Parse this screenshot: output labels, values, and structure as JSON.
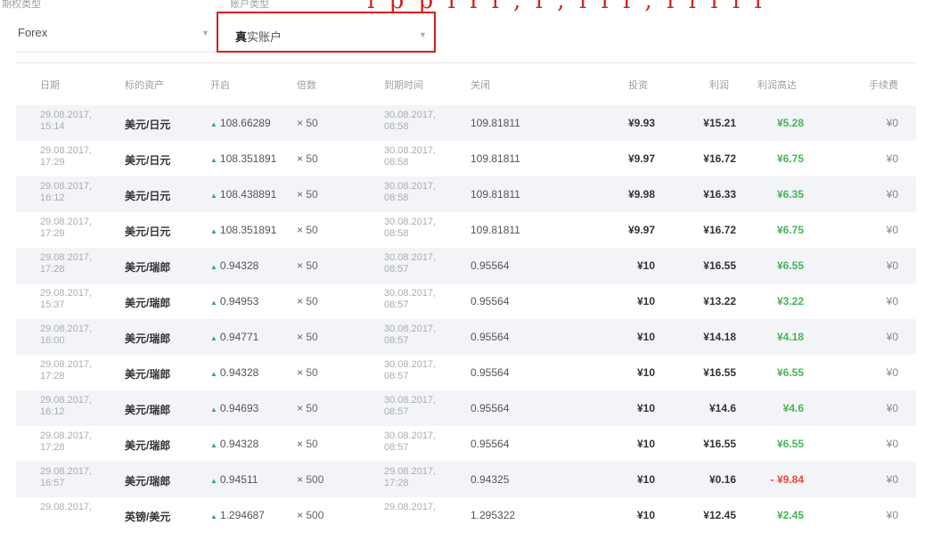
{
  "top": {
    "option_type_label": "期权类型",
    "account_type_label": "账户类型",
    "annotation": "ı p p ı ı ı , ı , ı ı ı , ı ı ı ı ı"
  },
  "filters": {
    "option_type_value": "Forex",
    "account_type_bold": "真",
    "account_type_value": "实账户"
  },
  "table": {
    "headers": [
      "日期",
      "标的资产",
      "开启",
      "倍数",
      "到期时间",
      "关闭",
      "投资",
      "利润",
      "利润高达",
      "手续费"
    ],
    "rows": [
      {
        "date": "29.08.2017, 15:14",
        "asset": "美元/日元",
        "open": "108.66289",
        "mult": "× 50",
        "expiry": "30.08.2017, 08:58",
        "close": "109.81811",
        "invest": "¥9.93",
        "pnl": "¥15.21",
        "profit": "¥5.28",
        "fee": "¥0"
      },
      {
        "date": "29.08.2017, 17:29",
        "asset": "美元/日元",
        "open": "108.351891",
        "mult": "× 50",
        "expiry": "30.08.2017, 08:58",
        "close": "109.81811",
        "invest": "¥9.97",
        "pnl": "¥16.72",
        "profit": "¥6.75",
        "fee": "¥0"
      },
      {
        "date": "29.08.2017, 16:12",
        "asset": "美元/日元",
        "open": "108.438891",
        "mult": "× 50",
        "expiry": "30.08.2017, 08:58",
        "close": "109.81811",
        "invest": "¥9.98",
        "pnl": "¥16.33",
        "profit": "¥6.35",
        "fee": "¥0"
      },
      {
        "date": "29.08.2017, 17:29",
        "asset": "美元/日元",
        "open": "108.351891",
        "mult": "× 50",
        "expiry": "30.08.2017, 08:58",
        "close": "109.81811",
        "invest": "¥9.97",
        "pnl": "¥16.72",
        "profit": "¥6.75",
        "fee": "¥0"
      },
      {
        "date": "29.08.2017, 17:28",
        "asset": "美元/瑞郎",
        "open": "0.94328",
        "mult": "× 50",
        "expiry": "30.08.2017, 08:57",
        "close": "0.95564",
        "invest": "¥10",
        "pnl": "¥16.55",
        "profit": "¥6.55",
        "fee": "¥0"
      },
      {
        "date": "29.08.2017, 15:37",
        "asset": "美元/瑞郎",
        "open": "0.94953",
        "mult": "× 50",
        "expiry": "30.08.2017, 08:57",
        "close": "0.95564",
        "invest": "¥10",
        "pnl": "¥13.22",
        "profit": "¥3.22",
        "fee": "¥0"
      },
      {
        "date": "29.08.2017, 16:00",
        "asset": "美元/瑞郎",
        "open": "0.94771",
        "mult": "× 50",
        "expiry": "30.08.2017, 08:57",
        "close": "0.95564",
        "invest": "¥10",
        "pnl": "¥14.18",
        "profit": "¥4.18",
        "fee": "¥0"
      },
      {
        "date": "29.08.2017, 17:28",
        "asset": "美元/瑞郎",
        "open": "0.94328",
        "mult": "× 50",
        "expiry": "30.08.2017, 08:57",
        "close": "0.95564",
        "invest": "¥10",
        "pnl": "¥16.55",
        "profit": "¥6.55",
        "fee": "¥0"
      },
      {
        "date": "29.08.2017, 16:12",
        "asset": "美元/瑞郎",
        "open": "0.94693",
        "mult": "× 50",
        "expiry": "30.08.2017, 08:57",
        "close": "0.95564",
        "invest": "¥10",
        "pnl": "¥14.6",
        "profit": "¥4.6",
        "fee": "¥0"
      },
      {
        "date": "29.08.2017, 17:28",
        "asset": "美元/瑞郎",
        "open": "0.94328",
        "mult": "× 50",
        "expiry": "30.08.2017, 08:57",
        "close": "0.95564",
        "invest": "¥10",
        "pnl": "¥16.55",
        "profit": "¥6.55",
        "fee": "¥0"
      },
      {
        "date": "29.08.2017, 16:57",
        "asset": "美元/瑞郎",
        "open": "0.94511",
        "mult": "× 500",
        "expiry": "29.08.2017, 17:28",
        "close": "0.94325",
        "invest": "¥10",
        "pnl": "¥0.16",
        "profit": "- ¥9.84",
        "fee": "¥0"
      },
      {
        "date": "29.08.2017,",
        "asset": "英镑/美元",
        "open": "1.294687",
        "mult": "× 500",
        "expiry": "29.08.2017,",
        "close": "1.295322",
        "invest": "¥10",
        "pnl": "¥12.45",
        "profit": "¥2.45",
        "fee": "¥0"
      }
    ]
  },
  "colors": {
    "highlight_border": "#d81d1d",
    "profit_positive": "#46b55a",
    "profit_negative": "#e24b3b",
    "up_arrow": "#27ae60",
    "row_stripe": "#f3f4f7"
  },
  "icons": {
    "open_direction": "triangle-up",
    "dropdown": "caret-down"
  }
}
